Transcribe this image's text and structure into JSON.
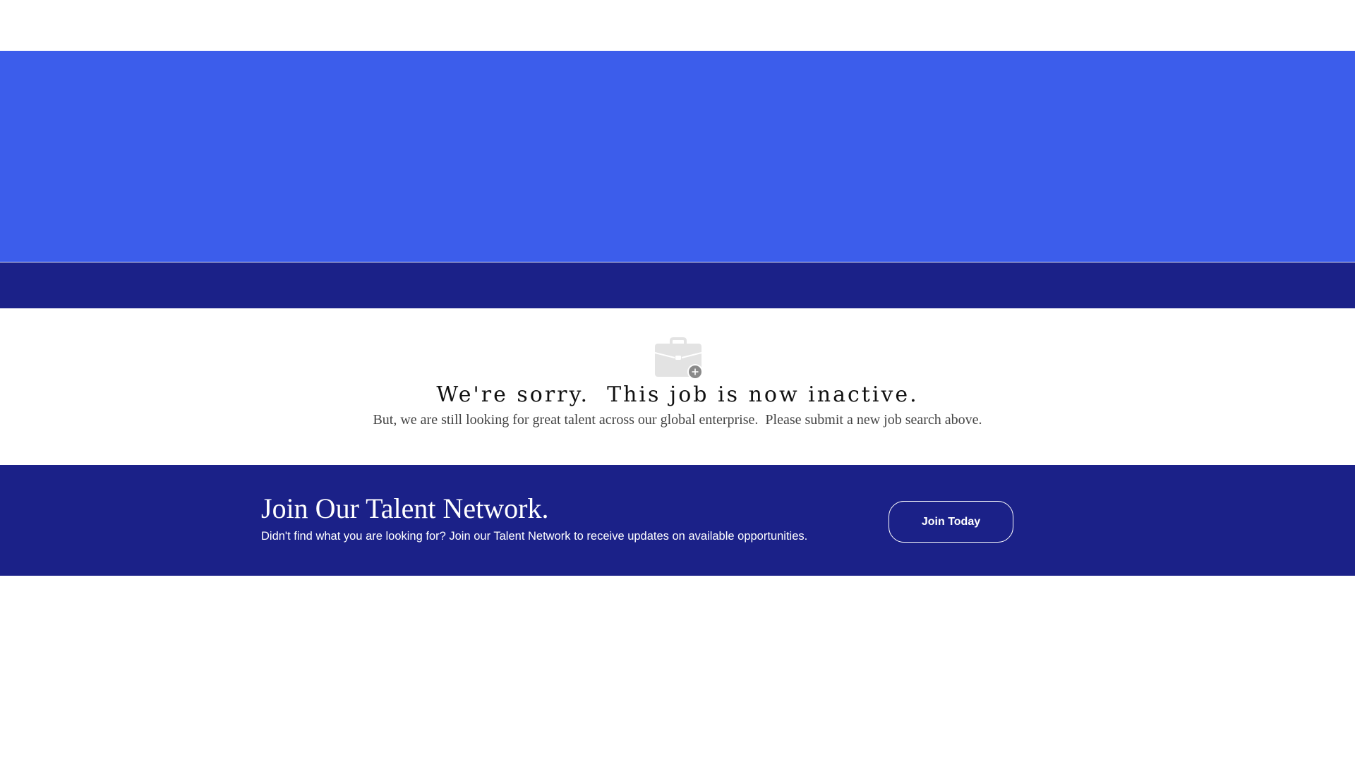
{
  "colors": {
    "hero_blue": "#3c5deb",
    "navy": "#1b2188",
    "icon_grey": "#e3e3e3",
    "badge_grey": "#8a8a8a"
  },
  "message": {
    "icon": "briefcase-add-icon",
    "title": "We're sorry.  This job is now inactive.",
    "subtitle": "But, we are still looking for great talent across our global enterprise.  Please submit a new job search above."
  },
  "talent_network": {
    "title": "Join Our Talent Network.",
    "description": "Didn't find what you are looking for? Join our Talent Network to receive updates on available opportunities.",
    "button_label": "Join Today"
  }
}
